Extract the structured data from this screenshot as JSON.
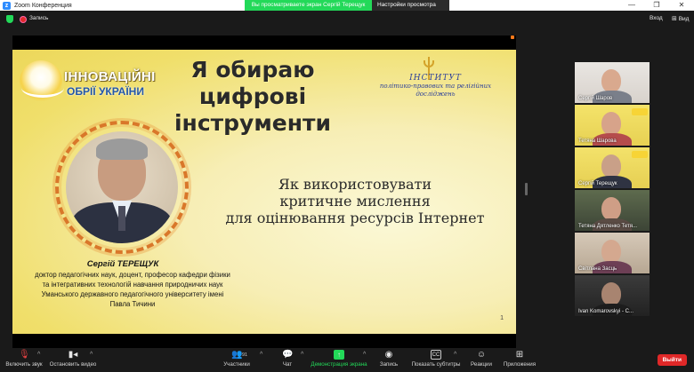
{
  "app": {
    "window_title": "Zoom Конференция",
    "share_banner": "Вы просматриваете экран Сергій Терещук",
    "view_settings": "Настройки просмотра",
    "window_controls": [
      "—",
      "❐",
      "✕"
    ],
    "colors": {
      "green": "#23d959",
      "leave": "#e02828",
      "dark": "#1a1a1a"
    }
  },
  "subbar": {
    "record_label": "Запись",
    "login_label": "Вход",
    "view_label": "Вид"
  },
  "slide": {
    "brand_line1": "ІННОВАЦІЙНІ",
    "brand_line2": "ОБРІЇ УКРАЇНИ",
    "title": "Я обираю цифрові інструменти",
    "institute_line1": "ІНСТИТУТ",
    "institute_line2": "політико-правових та релігійних",
    "institute_line3": "досліджень",
    "speaker_name": "Сергій ТЕРЕЩУК",
    "speaker_bio": "доктор педагогічних наук, доцент, професор кафедри фізики та інтегративних технологій навчання природничих наук Уманського державного педагогічного університету імені Павла Тичини",
    "topic_line1": "Як використовувати",
    "topic_line2": "критичне мислення",
    "topic_line3": "для оцінювання ресурсів Інтернет",
    "page_number": "1"
  },
  "participants": [
    {
      "name": "Сергій Шаров",
      "icon": "face-photo"
    },
    {
      "name": "Тетяна Шарова",
      "icon": "face-photo"
    },
    {
      "name": "Сергій Терещук",
      "icon": "face-photo",
      "active": true
    },
    {
      "name": "Тетяна Дятленко Тетя...",
      "icon": "face-photo"
    },
    {
      "name": "Світлана Засць",
      "icon": "face-photo"
    },
    {
      "name": "Ivan Komarovskyi - С...",
      "icon": "face-photo"
    }
  ],
  "toolbar": {
    "audio": "Включить звук",
    "video": "Остановить видео",
    "participants": "Участники",
    "participants_count": "91",
    "chat": "Чат",
    "share": "Демонстрация экрана",
    "record": "Запись",
    "captions": "Показать субтитры",
    "reactions": "Реакции",
    "apps": "Приложения",
    "leave": "Выйти",
    "captions_icon_text": "CC"
  }
}
